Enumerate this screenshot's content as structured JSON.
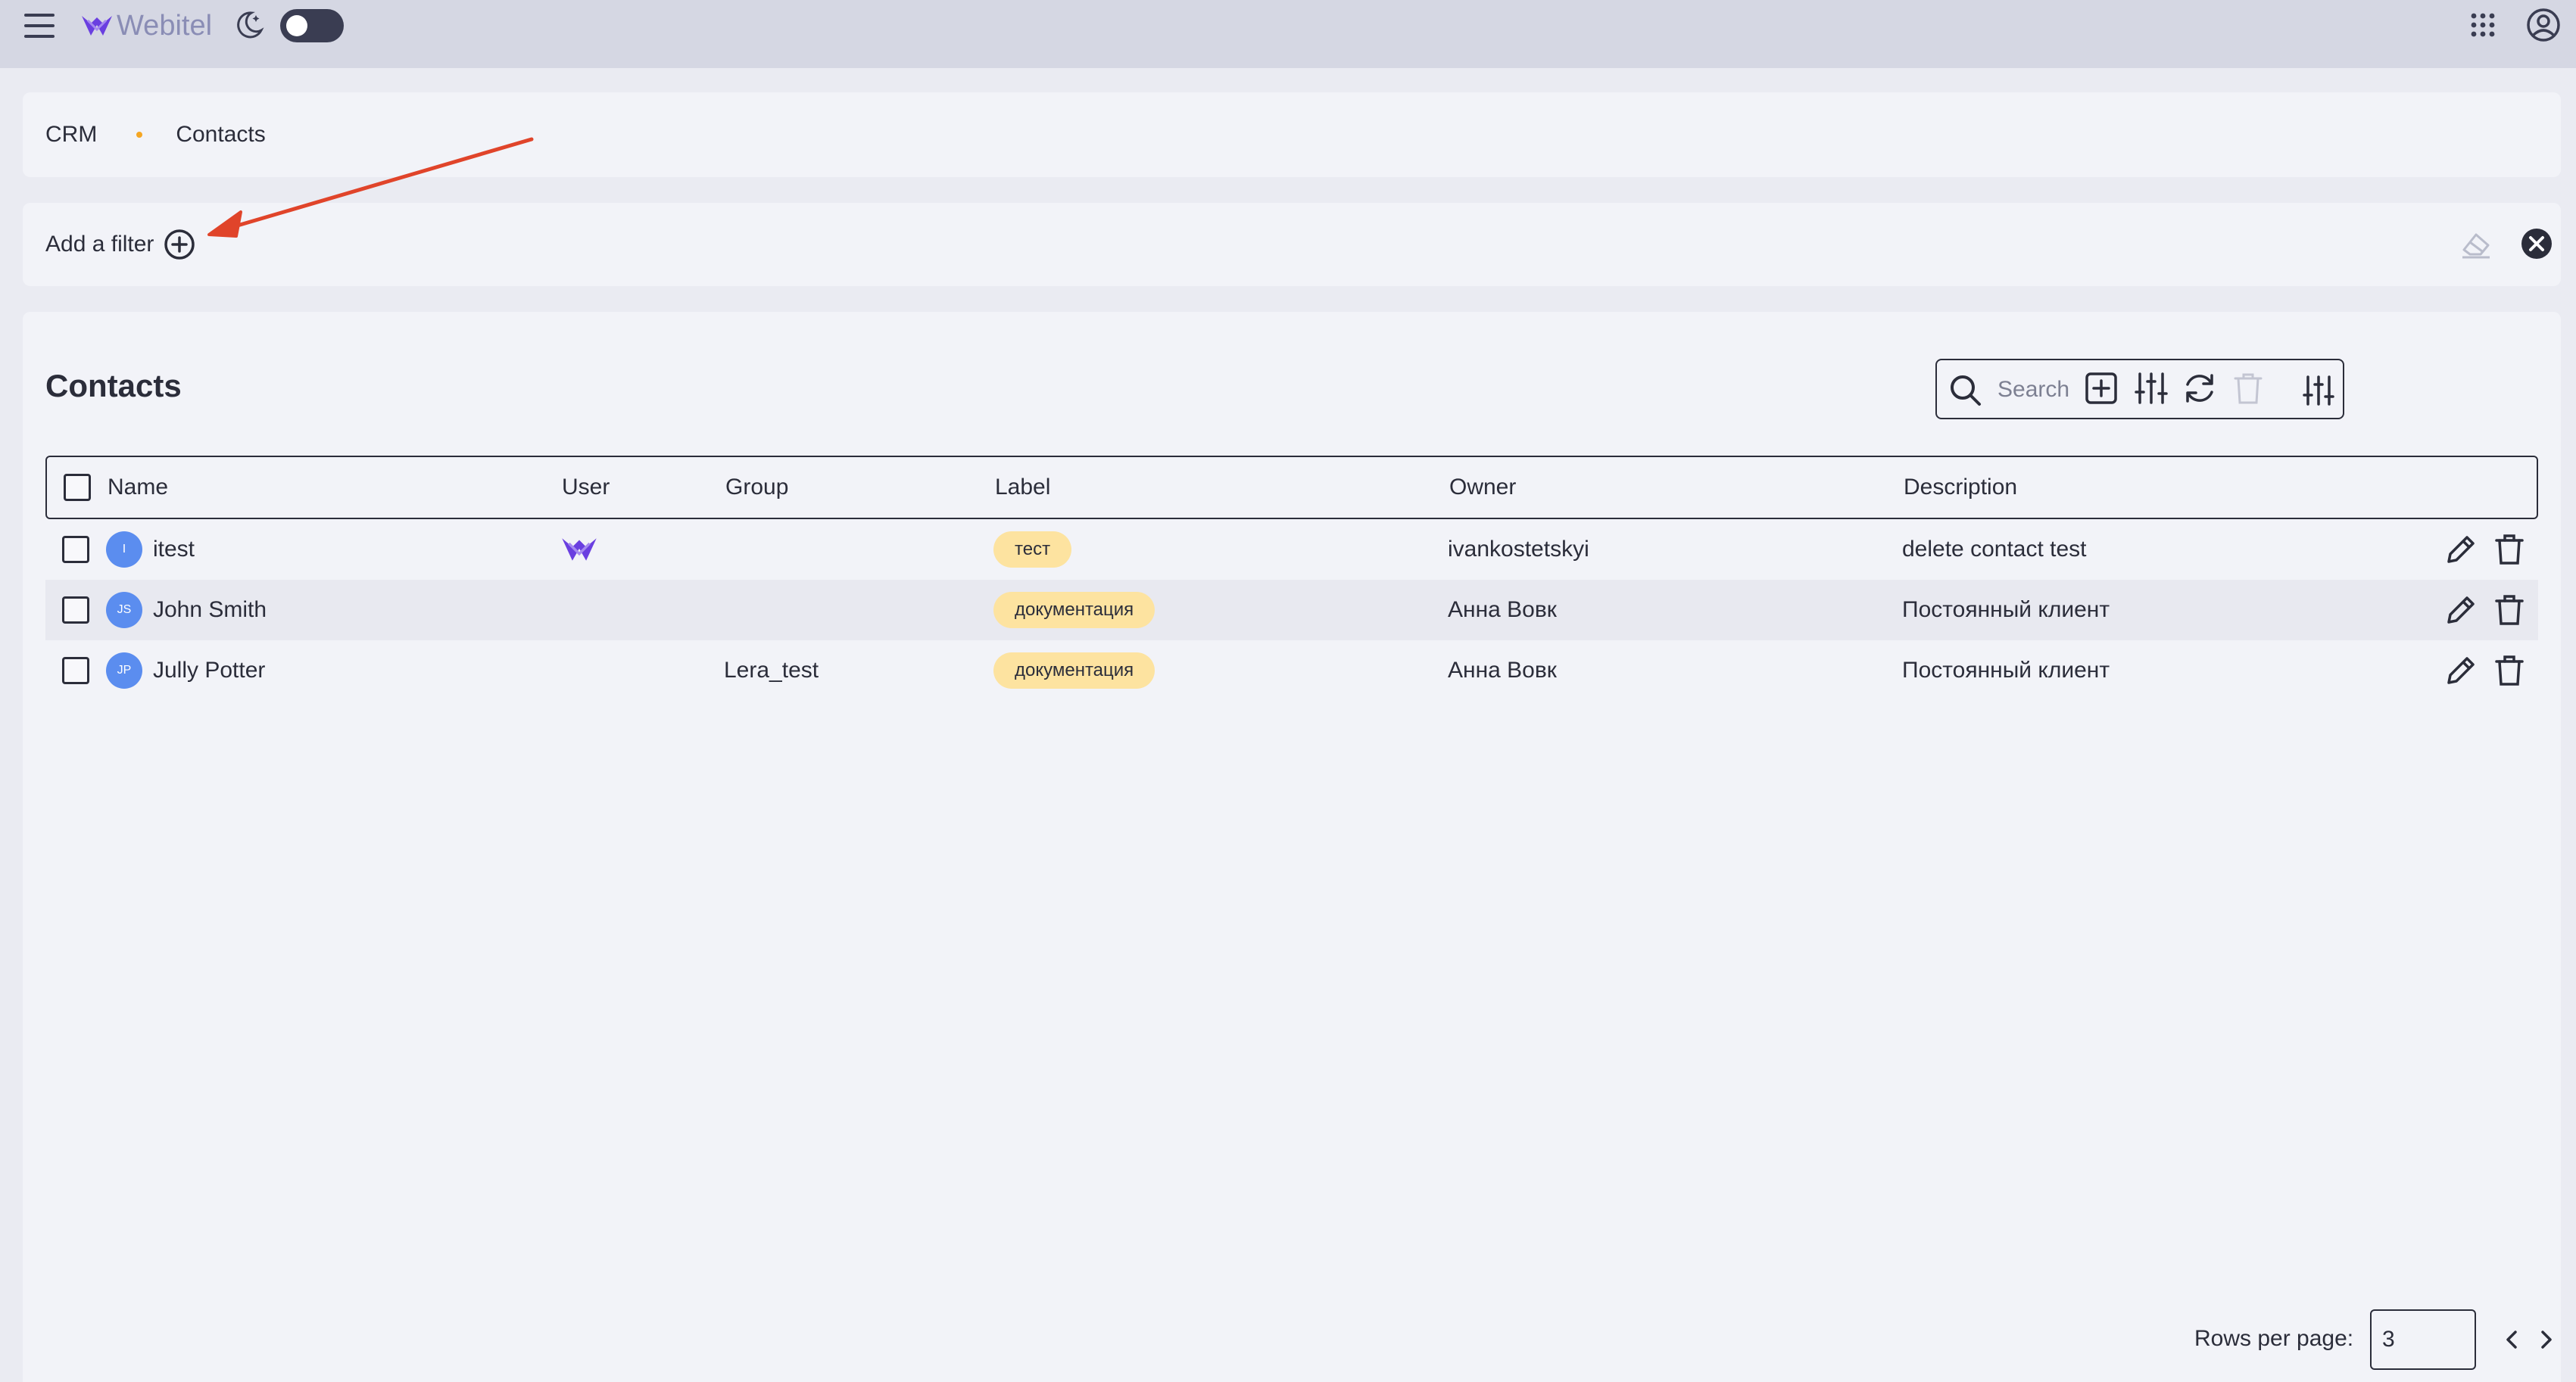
{
  "header": {
    "brand": "Webitel",
    "brand_color": "#6a3fe0",
    "theme_toggle": "off",
    "icons": [
      "menu-icon",
      "moon-icon",
      "apps-grid-icon",
      "account-icon"
    ]
  },
  "breadcrumb": {
    "items": [
      "CRM",
      "Contacts"
    ]
  },
  "filters": {
    "add_label": "Add a filter"
  },
  "main": {
    "title": "Contacts",
    "search": {
      "placeholder": "Search",
      "value": ""
    }
  },
  "table": {
    "columns": [
      "Name",
      "User",
      "Group",
      "Label",
      "Owner",
      "Description"
    ],
    "rows": [
      {
        "initials": "I",
        "name": "itest",
        "user_icon": "webitel-logo-icon",
        "group": "",
        "label": "тест",
        "owner": "ivankostetskyi",
        "description": "delete contact test"
      },
      {
        "initials": "JS",
        "name": "John Smith",
        "user_icon": "",
        "group": "",
        "label": "документация",
        "owner": "Анна Вовк",
        "description": "Постоянный клиент"
      },
      {
        "initials": "JP",
        "name": "Jully Potter",
        "user_icon": "",
        "group": "Lera_test",
        "label": "документация",
        "owner": "Анна Вовк",
        "description": "Постоянный клиент"
      }
    ]
  },
  "pagination": {
    "rows_per_page_label": "Rows per page:",
    "rows_per_page": "3"
  },
  "annotation": {
    "color": "#e0442a"
  }
}
